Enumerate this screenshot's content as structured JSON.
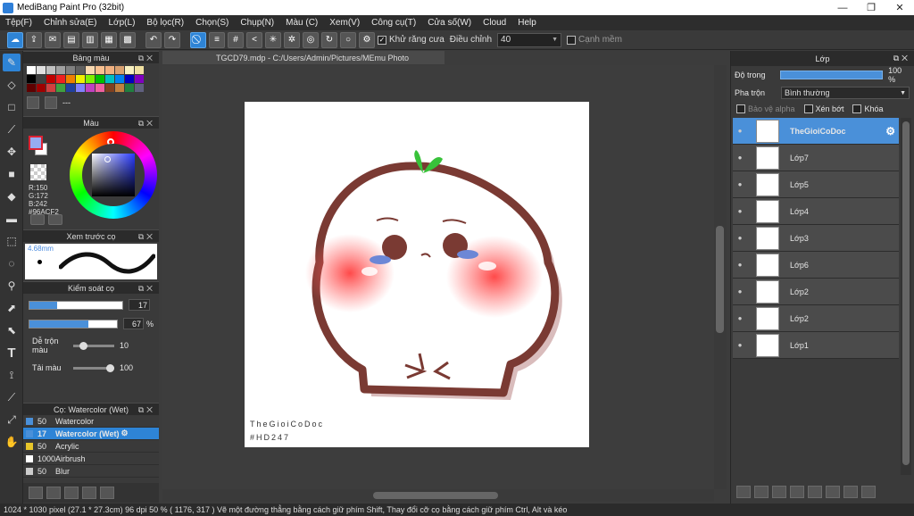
{
  "window": {
    "title": "MediBang Paint Pro (32bit)",
    "minimize": "—",
    "maximize": "❐",
    "close": "✕"
  },
  "menu": [
    "Tệp(F)",
    "Chỉnh sửa(E)",
    "Lớp(L)",
    "Bộ lọc(R)",
    "Chọn(S)",
    "Chụp(N)",
    "Màu (C)",
    "Xem(V)",
    "Công cụ(T)",
    "Cửa số(W)",
    "Cloud",
    "Help"
  ],
  "toolbar": {
    "antialias_label": "Khử răng cưa",
    "adjust_label": "Điều chỉnh",
    "adjust_value": "40",
    "smooth_label": "Cạnh mềm"
  },
  "panels": {
    "palette": {
      "title": "Bảng màu",
      "extra": "---"
    },
    "color": {
      "title": "Màu",
      "r": "R:150",
      "g": "G:172",
      "b": "B:242",
      "hex": "#96ACF2",
      "fg": "#96ACF2"
    },
    "brush_preview": {
      "title": "Xem trước cọ",
      "size": "4.68mm"
    },
    "brush_control": {
      "title": "Kiểm soát cọ",
      "size_value": "17",
      "size_fill_percent": 30,
      "opacity_value": "67",
      "opacity_unit": "%",
      "opacity_fill_percent": 67,
      "mix_label": "Dễ trộn màu",
      "mix_value": "10",
      "mix_fraction": 0.2,
      "amount_label": "Tải màu",
      "amount_value": "100",
      "amount_fraction": 1.0
    },
    "brushes": {
      "title": "Cọ: Watercolor (Wet)",
      "items": [
        {
          "num": "50",
          "name": "Watercolor",
          "color": "#4a90d9",
          "selected": false
        },
        {
          "num": "17",
          "name": "Watercolor (Wet)",
          "color": "#4a90d9",
          "selected": true
        },
        {
          "num": "50",
          "name": "Acrylic",
          "color": "#e8c62a",
          "selected": false
        },
        {
          "num": "1000",
          "name": "Airbrush",
          "color": "#ffffff",
          "selected": false
        },
        {
          "num": "50",
          "name": "Blur",
          "color": "#cccccc",
          "selected": false
        }
      ]
    }
  },
  "document": {
    "tab": "TGCD79.mdp - C:/Users/Admin/Pictures/MEmu Photo",
    "watermark_line1": "TheGioiCoDoc",
    "watermark_line2": "#HD247"
  },
  "layers_panel": {
    "title": "Lớp",
    "opacity_label": "Độ trong",
    "opacity_value": "100 %",
    "blend_label": "Pha trộn",
    "blend_value": "Bình thường",
    "protect_alpha": "Bảo vệ alpha",
    "clipping": "Xén bớt",
    "lock": "Khóa",
    "layers": [
      {
        "name": "TheGioiCoDoc",
        "selected": true
      },
      {
        "name": "Lớp7",
        "selected": false
      },
      {
        "name": "Lớp5",
        "selected": false
      },
      {
        "name": "Lớp4",
        "selected": false
      },
      {
        "name": "Lớp3",
        "selected": false
      },
      {
        "name": "Lớp6",
        "selected": false
      },
      {
        "name": "Lớp2",
        "selected": false
      },
      {
        "name": "Lớp2",
        "selected": false
      },
      {
        "name": "Lớp1",
        "selected": false
      }
    ]
  },
  "status": {
    "text": "1024 * 1030 pixel   (27.1 * 27.3cm)   96 dpi   50 %   ( 1176, 317 )   Vẽ một đường thẳng bằng cách giữ phím Shift, Thay đổi cỡ cọ bằng cách giữ phím Ctrl, Alt và kéo"
  },
  "palette_colors": [
    "#ffffff",
    "#e0e0e0",
    "#c0c0c0",
    "#a0a0a0",
    "#808080",
    "#606060",
    "#f8d8b0",
    "#f8c090",
    "#f0b080",
    "#d8a070",
    "#f8f0c0",
    "#f0e0a0",
    "#000000",
    "#404040",
    "#c00000",
    "#f02020",
    "#f08000",
    "#f0f000",
    "#80f000",
    "#00c000",
    "#00c0c0",
    "#0080f0",
    "#0000c0",
    "#8000c0",
    "#600000",
    "#a00000",
    "#d04040",
    "#40a040",
    "#2040a0",
    "#8080ff",
    "#c040c0",
    "#f060a0",
    "#804020",
    "#c08040",
    "#208040",
    "#606080"
  ]
}
